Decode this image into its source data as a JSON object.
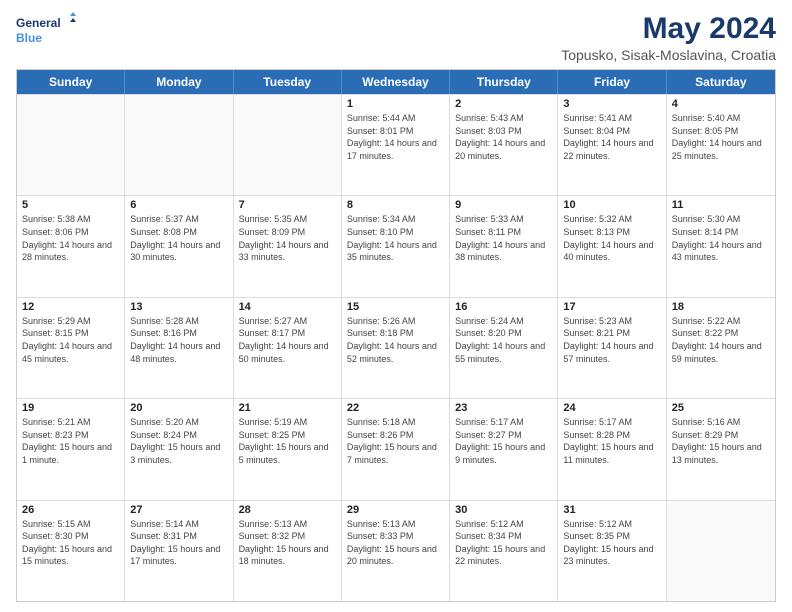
{
  "header": {
    "logo_line1": "General",
    "logo_line2": "Blue",
    "title": "May 2024",
    "subtitle": "Topusko, Sisak-Moslavina, Croatia"
  },
  "calendar": {
    "days_of_week": [
      "Sunday",
      "Monday",
      "Tuesday",
      "Wednesday",
      "Thursday",
      "Friday",
      "Saturday"
    ],
    "weeks": [
      [
        {
          "day": "",
          "empty": true
        },
        {
          "day": "",
          "empty": true
        },
        {
          "day": "",
          "empty": true
        },
        {
          "day": "1",
          "sunrise": "5:44 AM",
          "sunset": "8:01 PM",
          "daylight": "14 hours and 17 minutes."
        },
        {
          "day": "2",
          "sunrise": "5:43 AM",
          "sunset": "8:03 PM",
          "daylight": "14 hours and 20 minutes."
        },
        {
          "day": "3",
          "sunrise": "5:41 AM",
          "sunset": "8:04 PM",
          "daylight": "14 hours and 22 minutes."
        },
        {
          "day": "4",
          "sunrise": "5:40 AM",
          "sunset": "8:05 PM",
          "daylight": "14 hours and 25 minutes."
        }
      ],
      [
        {
          "day": "5",
          "sunrise": "5:38 AM",
          "sunset": "8:06 PM",
          "daylight": "14 hours and 28 minutes."
        },
        {
          "day": "6",
          "sunrise": "5:37 AM",
          "sunset": "8:08 PM",
          "daylight": "14 hours and 30 minutes."
        },
        {
          "day": "7",
          "sunrise": "5:35 AM",
          "sunset": "8:09 PM",
          "daylight": "14 hours and 33 minutes."
        },
        {
          "day": "8",
          "sunrise": "5:34 AM",
          "sunset": "8:10 PM",
          "daylight": "14 hours and 35 minutes."
        },
        {
          "day": "9",
          "sunrise": "5:33 AM",
          "sunset": "8:11 PM",
          "daylight": "14 hours and 38 minutes."
        },
        {
          "day": "10",
          "sunrise": "5:32 AM",
          "sunset": "8:13 PM",
          "daylight": "14 hours and 40 minutes."
        },
        {
          "day": "11",
          "sunrise": "5:30 AM",
          "sunset": "8:14 PM",
          "daylight": "14 hours and 43 minutes."
        }
      ],
      [
        {
          "day": "12",
          "sunrise": "5:29 AM",
          "sunset": "8:15 PM",
          "daylight": "14 hours and 45 minutes."
        },
        {
          "day": "13",
          "sunrise": "5:28 AM",
          "sunset": "8:16 PM",
          "daylight": "14 hours and 48 minutes."
        },
        {
          "day": "14",
          "sunrise": "5:27 AM",
          "sunset": "8:17 PM",
          "daylight": "14 hours and 50 minutes."
        },
        {
          "day": "15",
          "sunrise": "5:26 AM",
          "sunset": "8:18 PM",
          "daylight": "14 hours and 52 minutes."
        },
        {
          "day": "16",
          "sunrise": "5:24 AM",
          "sunset": "8:20 PM",
          "daylight": "14 hours and 55 minutes."
        },
        {
          "day": "17",
          "sunrise": "5:23 AM",
          "sunset": "8:21 PM",
          "daylight": "14 hours and 57 minutes."
        },
        {
          "day": "18",
          "sunrise": "5:22 AM",
          "sunset": "8:22 PM",
          "daylight": "14 hours and 59 minutes."
        }
      ],
      [
        {
          "day": "19",
          "sunrise": "5:21 AM",
          "sunset": "8:23 PM",
          "daylight": "15 hours and 1 minute."
        },
        {
          "day": "20",
          "sunrise": "5:20 AM",
          "sunset": "8:24 PM",
          "daylight": "15 hours and 3 minutes."
        },
        {
          "day": "21",
          "sunrise": "5:19 AM",
          "sunset": "8:25 PM",
          "daylight": "15 hours and 5 minutes."
        },
        {
          "day": "22",
          "sunrise": "5:18 AM",
          "sunset": "8:26 PM",
          "daylight": "15 hours and 7 minutes."
        },
        {
          "day": "23",
          "sunrise": "5:17 AM",
          "sunset": "8:27 PM",
          "daylight": "15 hours and 9 minutes."
        },
        {
          "day": "24",
          "sunrise": "5:17 AM",
          "sunset": "8:28 PM",
          "daylight": "15 hours and 11 minutes."
        },
        {
          "day": "25",
          "sunrise": "5:16 AM",
          "sunset": "8:29 PM",
          "daylight": "15 hours and 13 minutes."
        }
      ],
      [
        {
          "day": "26",
          "sunrise": "5:15 AM",
          "sunset": "8:30 PM",
          "daylight": "15 hours and 15 minutes."
        },
        {
          "day": "27",
          "sunrise": "5:14 AM",
          "sunset": "8:31 PM",
          "daylight": "15 hours and 17 minutes."
        },
        {
          "day": "28",
          "sunrise": "5:13 AM",
          "sunset": "8:32 PM",
          "daylight": "15 hours and 18 minutes."
        },
        {
          "day": "29",
          "sunrise": "5:13 AM",
          "sunset": "8:33 PM",
          "daylight": "15 hours and 20 minutes."
        },
        {
          "day": "30",
          "sunrise": "5:12 AM",
          "sunset": "8:34 PM",
          "daylight": "15 hours and 22 minutes."
        },
        {
          "day": "31",
          "sunrise": "5:12 AM",
          "sunset": "8:35 PM",
          "daylight": "15 hours and 23 minutes."
        },
        {
          "day": "",
          "empty": true
        }
      ]
    ]
  }
}
